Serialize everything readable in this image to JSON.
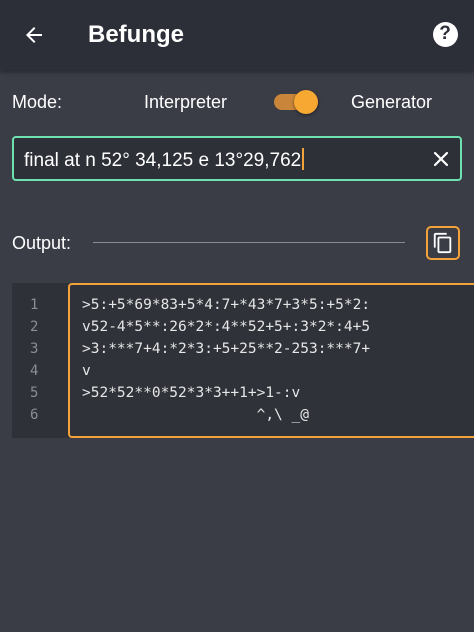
{
  "appbar": {
    "title": "Befunge",
    "back_icon": "arrow-left-icon",
    "help_icon": "help-circle-icon",
    "help_glyph": "?"
  },
  "mode": {
    "label": "Mode:",
    "left_option": "Interpreter",
    "right_option": "Generator",
    "toggle_on": true,
    "accent": "#f7a833"
  },
  "input": {
    "value": "final at n 52° 34,125 e 13°29,762",
    "border_color": "#6fe0b0",
    "clear_icon": "close-icon"
  },
  "output": {
    "label": "Output:",
    "copy_icon": "copy-icon"
  },
  "code": {
    "line_numbers": [
      "1",
      "2",
      "3",
      "4",
      "5",
      "6"
    ],
    "lines": [
      ">5:+5*69*83+5*4:7+*43*7+3*5:+5*2:",
      "v52-4*5**:26*2*:4**52+5+:3*2*:4+5",
      ">3:***7+4:*2*3:+5+25**2-253:***7+",
      "v",
      ">52*52**0*52*3*3++1+>1-:v",
      "                    ^,\\ _@"
    ]
  }
}
